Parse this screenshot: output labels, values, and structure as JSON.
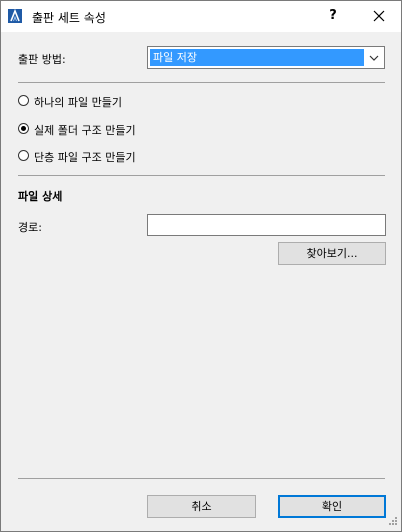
{
  "window": {
    "title": "출판 세트 속성",
    "help_label": "?",
    "app_icon": "archicad-logo-icon",
    "close_icon": "close-icon"
  },
  "publish_method": {
    "label": "출판 방법:",
    "selected": "파일 저장",
    "arrow_icon": "chevron-down-icon",
    "highlight_color": "#3399ff"
  },
  "options": [
    {
      "label": "하나의 파일 만들기",
      "checked": false
    },
    {
      "label": "실제 폴더 구조 만들기",
      "checked": true
    },
    {
      "label": "단층 파일 구조 만들기",
      "checked": false
    }
  ],
  "file_details": {
    "section_title": "파일 상세",
    "path_label": "경로:",
    "path_value": "",
    "browse_label": "찾아보기..."
  },
  "footer": {
    "cancel_label": "취소",
    "ok_label": "확인"
  },
  "colors": {
    "accent": "#0078d7",
    "dialog_bg": "#f0f0f0"
  }
}
